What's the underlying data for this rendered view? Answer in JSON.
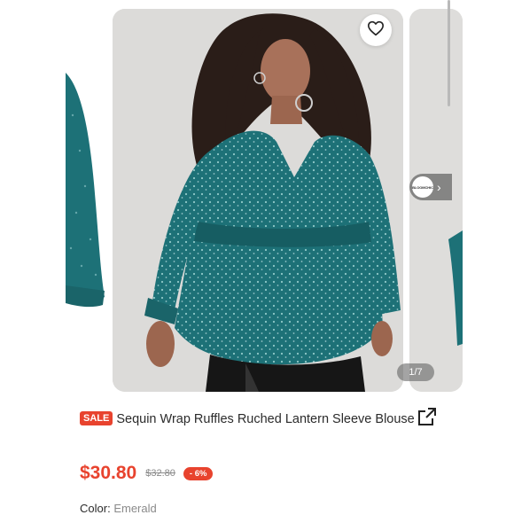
{
  "gallery": {
    "counter": "1/7",
    "favorite_icon": "heart-outline-icon",
    "brand_chip": {
      "logo_text": "BLOOMCHIC",
      "arrow_icon": "chevron-right-icon"
    }
  },
  "product": {
    "sale_badge": "SALE",
    "title": "Sequin Wrap Ruffles Ruched Lantern Sleeve Blouse",
    "share_icon": "share-external-icon",
    "price": "$30.80",
    "original_price": "$32.80",
    "discount": "- 6%",
    "color_label": "Color",
    "color_value": "Emerald"
  },
  "colors": {
    "accent": "#e8432e",
    "emerald": "#1d7177"
  }
}
